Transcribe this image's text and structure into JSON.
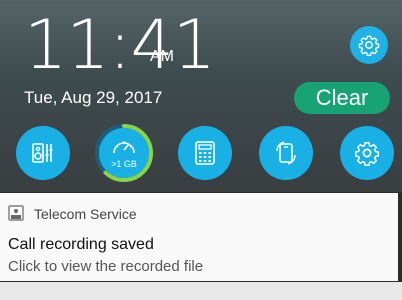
{
  "shade": {
    "time": "11:41",
    "ampm": "AM",
    "date": "Tue, Aug 29, 2017",
    "clear_label": "Clear",
    "accent": "#19b0e6",
    "clear_color": "#17a374",
    "settings_icon": "gear-icon"
  },
  "quick_toggles": [
    {
      "name": "audio-wizard",
      "icon": "audio-equalizer-icon"
    },
    {
      "name": "boost",
      "icon": "speedometer-icon",
      "label": ">1 GB",
      "ring_percent": 62
    },
    {
      "name": "calculator",
      "icon": "calculator-icon"
    },
    {
      "name": "screen-rotate",
      "icon": "rotate-icon"
    },
    {
      "name": "settings",
      "icon": "gear-icon"
    }
  ],
  "notification": {
    "app": "Telecom Service",
    "app_icon": "rec-icon",
    "title": "Call recording saved",
    "text": "Click to view the recorded file"
  }
}
